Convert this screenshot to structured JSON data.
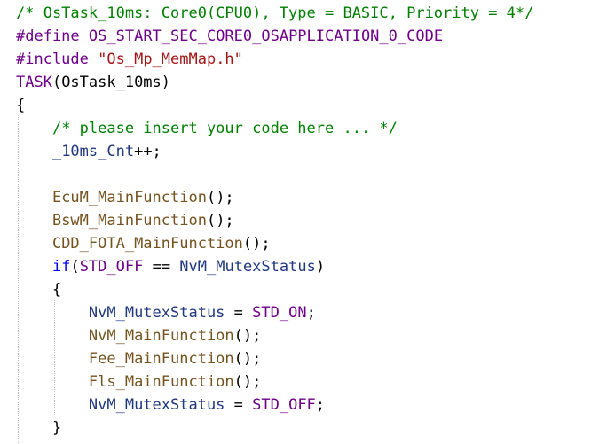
{
  "editor": {
    "lines": [
      {
        "tokens": [
          {
            "t": "/* OsTask_10ms: Core0(CPU0), Type = BASIC, Priority = 4*/",
            "c": "com"
          }
        ]
      },
      {
        "tokens": [
          {
            "t": "#define",
            "c": "pre"
          },
          {
            "t": " ",
            "c": "pun"
          },
          {
            "t": "OS_START_SEC_CORE0_OSAPPLICATION_0_CODE",
            "c": "mac"
          }
        ]
      },
      {
        "tokens": [
          {
            "t": "#include",
            "c": "pre"
          },
          {
            "t": " ",
            "c": "pun"
          },
          {
            "t": "\"Os_Mp_MemMap.h\"",
            "c": "str"
          }
        ]
      },
      {
        "tokens": [
          {
            "t": "TASK",
            "c": "mac"
          },
          {
            "t": "(OsTask_10ms)",
            "c": "pun"
          }
        ]
      },
      {
        "tokens": [
          {
            "t": "{",
            "c": "pun"
          }
        ]
      },
      {
        "tokens": [
          {
            "t": "    ",
            "c": "pun"
          },
          {
            "t": "/* please insert your code here ... */",
            "c": "com"
          }
        ]
      },
      {
        "tokens": [
          {
            "t": "    ",
            "c": "pun"
          },
          {
            "t": "_10ms_Cnt",
            "c": "var"
          },
          {
            "t": "++;",
            "c": "pun"
          }
        ]
      },
      {
        "tokens": []
      },
      {
        "tokens": [
          {
            "t": "    ",
            "c": "pun"
          },
          {
            "t": "EcuM_MainFunction",
            "c": "fn"
          },
          {
            "t": "();",
            "c": "pun"
          }
        ]
      },
      {
        "tokens": [
          {
            "t": "    ",
            "c": "pun"
          },
          {
            "t": "BswM_MainFunction",
            "c": "fn"
          },
          {
            "t": "();",
            "c": "pun"
          }
        ]
      },
      {
        "tokens": [
          {
            "t": "    ",
            "c": "pun"
          },
          {
            "t": "CDD_FOTA_MainFunction",
            "c": "fn"
          },
          {
            "t": "();",
            "c": "pun"
          }
        ]
      },
      {
        "tokens": [
          {
            "t": "    ",
            "c": "pun"
          },
          {
            "t": "if",
            "c": "kw"
          },
          {
            "t": "(",
            "c": "pun"
          },
          {
            "t": "STD_OFF",
            "c": "mac"
          },
          {
            "t": " == ",
            "c": "pun"
          },
          {
            "t": "NvM_MutexStatus",
            "c": "var"
          },
          {
            "t": ")",
            "c": "pun"
          }
        ]
      },
      {
        "tokens": [
          {
            "t": "    ",
            "c": "pun"
          },
          {
            "t": "{",
            "c": "pun"
          }
        ]
      },
      {
        "tokens": [
          {
            "t": "        ",
            "c": "pun"
          },
          {
            "t": "NvM_MutexStatus",
            "c": "var"
          },
          {
            "t": " = ",
            "c": "pun"
          },
          {
            "t": "STD_ON",
            "c": "mac"
          },
          {
            "t": ";",
            "c": "pun"
          }
        ]
      },
      {
        "tokens": [
          {
            "t": "        ",
            "c": "pun"
          },
          {
            "t": "NvM_MainFunction",
            "c": "fn"
          },
          {
            "t": "();",
            "c": "pun"
          }
        ]
      },
      {
        "tokens": [
          {
            "t": "        ",
            "c": "pun"
          },
          {
            "t": "Fee_MainFunction",
            "c": "fn"
          },
          {
            "t": "();",
            "c": "pun"
          }
        ]
      },
      {
        "tokens": [
          {
            "t": "        ",
            "c": "pun"
          },
          {
            "t": "Fls_MainFunction",
            "c": "fn"
          },
          {
            "t": "();",
            "c": "pun"
          }
        ]
      },
      {
        "tokens": [
          {
            "t": "        ",
            "c": "pun"
          },
          {
            "t": "NvM_MutexStatus",
            "c": "var"
          },
          {
            "t": " = ",
            "c": "pun"
          },
          {
            "t": "STD_OFF",
            "c": "mac"
          },
          {
            "t": ";",
            "c": "pun"
          }
        ]
      },
      {
        "tokens": [
          {
            "t": "    ",
            "c": "pun"
          },
          {
            "t": "}",
            "c": "pun"
          }
        ]
      }
    ]
  },
  "colors": {
    "comment": "#008000",
    "preprocessor": "#6f008a",
    "string": "#a31515",
    "macro": "#6f008a",
    "function": "#74531f",
    "keyword": "#0000ff",
    "variable": "#1f377f",
    "punctuation": "#000000",
    "indent_guide": "#bdbdbd",
    "background": "#ffffff"
  }
}
